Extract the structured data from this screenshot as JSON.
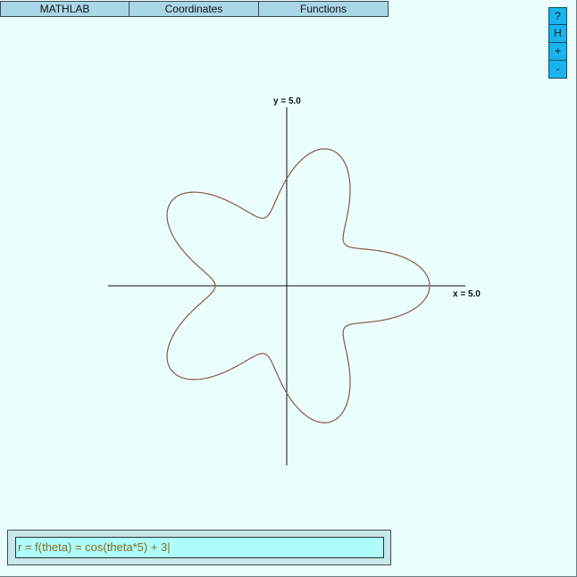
{
  "menu": {
    "tabs": [
      {
        "label": "MATHLAB"
      },
      {
        "label": "Coordinates"
      },
      {
        "label": "Functions"
      }
    ]
  },
  "side_buttons": [
    "?",
    "H",
    "+",
    "-"
  ],
  "plot": {
    "x_axis_label": "x = 5.0",
    "y_axis_label": "y = 5.0",
    "curve_color": "#8b5a3c",
    "x_range": [
      -5,
      5
    ],
    "y_range": [
      -5,
      5
    ],
    "function": {
      "type": "polar",
      "k": 5,
      "c": 3
    }
  },
  "input": {
    "value": "r = f(theta) = cos(theta*5) + 3|"
  },
  "colors": {
    "background": "#ebfefe",
    "menu_tab": "#a9d7e6",
    "side_button": "#19b4ec",
    "input_field": "#aefcfc",
    "input_text": "#8a6a1a"
  }
}
